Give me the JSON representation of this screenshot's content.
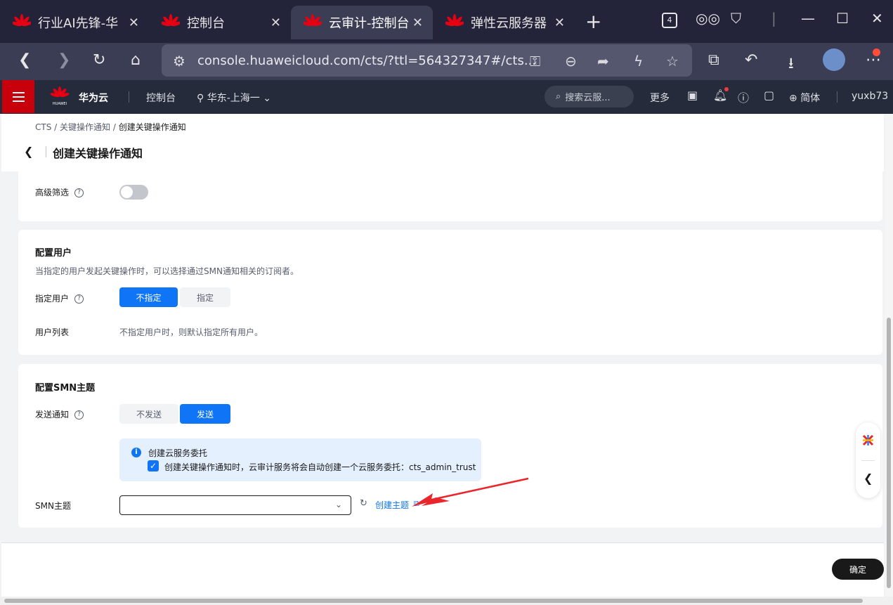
{
  "browser": {
    "tabs": [
      {
        "title": "行业AI先锋-华",
        "close": "✕"
      },
      {
        "title": "控制台",
        "close": "✕"
      },
      {
        "title": "云审计-控制台",
        "close": "✕"
      },
      {
        "title": "弹性云服务器",
        "close": "✕"
      }
    ],
    "new_tab": "+",
    "tab_count": "4",
    "url": "console.huaweicloud.com/cts/?ttl=564327347#/cts...",
    "colors": {
      "tabbar": "#23243a",
      "active_tab": "#3b3d54"
    }
  },
  "console": {
    "brand": "华为云",
    "brand_logo_text": "HUAWEI",
    "nav_console": "控制台",
    "region": "华东-上海一",
    "search_placeholder": "搜索云服...",
    "more": "更多",
    "lang": "简体",
    "user": "yuxb73",
    "accent": "#c7000b"
  },
  "breadcrumb": {
    "root": "CTS",
    "sep": "/",
    "parent": "关键操作通知",
    "current": "创建关键操作通知"
  },
  "page_title": "创建关键操作通知",
  "advanced": {
    "label": "高级筛选",
    "enabled": false
  },
  "user_config": {
    "title": "配置用户",
    "desc": "当指定的用户发起关键操作时，可以选择通过SMN通知相关的订阅者。",
    "specify_label": "指定用户",
    "options": [
      "不指定",
      "指定"
    ],
    "selected": "不指定",
    "list_label": "用户列表",
    "list_value": "不指定用户时，则默认指定所有用户。"
  },
  "smn_config": {
    "title": "配置SMN主题",
    "send_label": "发送通知",
    "options": [
      "不发送",
      "发送"
    ],
    "selected": "发送",
    "info_title": "创建云服务委托",
    "info_checkbox_text": "创建关键操作通知时，云审计服务将会自动创建一个云服务委托：cts_admin_trust",
    "info_checked": true,
    "topic_label": "SMN主题",
    "topic_value": "",
    "create_topic": "创建主题"
  },
  "footer": {
    "confirm": "确定"
  },
  "colors": {
    "primary": "#0f74f5",
    "annotation_arrow": "#e8262c"
  }
}
